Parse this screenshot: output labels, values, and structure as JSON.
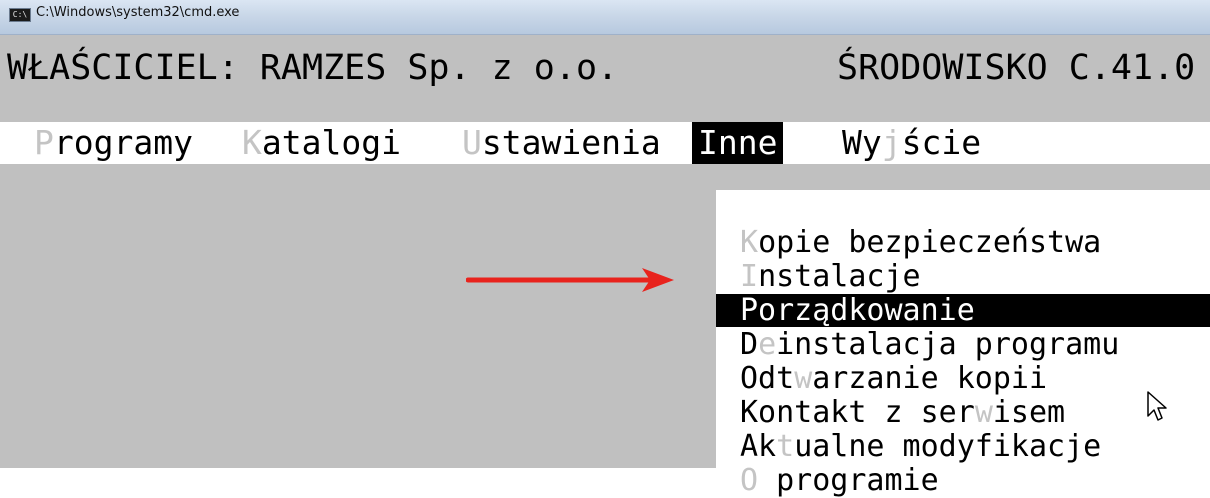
{
  "window": {
    "title": "C:\\Windows\\system32\\cmd.exe",
    "icon": "cmd-icon"
  },
  "header": {
    "owner": "WŁAŚCICIEL: RAMZES Sp. z o.o.",
    "environment": "ŚRODOWISKO C.41.0"
  },
  "menu": {
    "items": [
      {
        "hot": "P",
        "rest": "rogramy"
      },
      {
        "hot": "K",
        "rest": "atalogi"
      },
      {
        "hot": "U",
        "rest": "stawienia"
      },
      {
        "hot": "",
        "rest": "Inne"
      },
      {
        "pre": "Wy",
        "hot": "j",
        "rest": "ście"
      }
    ]
  },
  "dropdown": {
    "items": [
      {
        "pre": "",
        "hot": "K",
        "rest": "opie bezpieczeństwa"
      },
      {
        "pre": "",
        "hot": "I",
        "rest": "nstalacje"
      },
      {
        "pre": "",
        "hot": "",
        "rest": "Porządkowanie"
      },
      {
        "pre": "D",
        "hot": "e",
        "rest": "instalacja programu"
      },
      {
        "pre": "Odt",
        "hot": "w",
        "rest": "arzanie kopii"
      },
      {
        "pre": "Kontakt z ser",
        "hot": "w",
        "rest": "isem"
      },
      {
        "pre": "Ak",
        "hot": "t",
        "rest": "ualne modyfikacje"
      },
      {
        "pre": "",
        "hot": "O",
        "rest": " programie"
      }
    ],
    "selected_index": 2
  },
  "colors": {
    "console_bg": "#c0c0c0",
    "hotkey": "#c4c4c4",
    "arrow": "#e8231d"
  }
}
